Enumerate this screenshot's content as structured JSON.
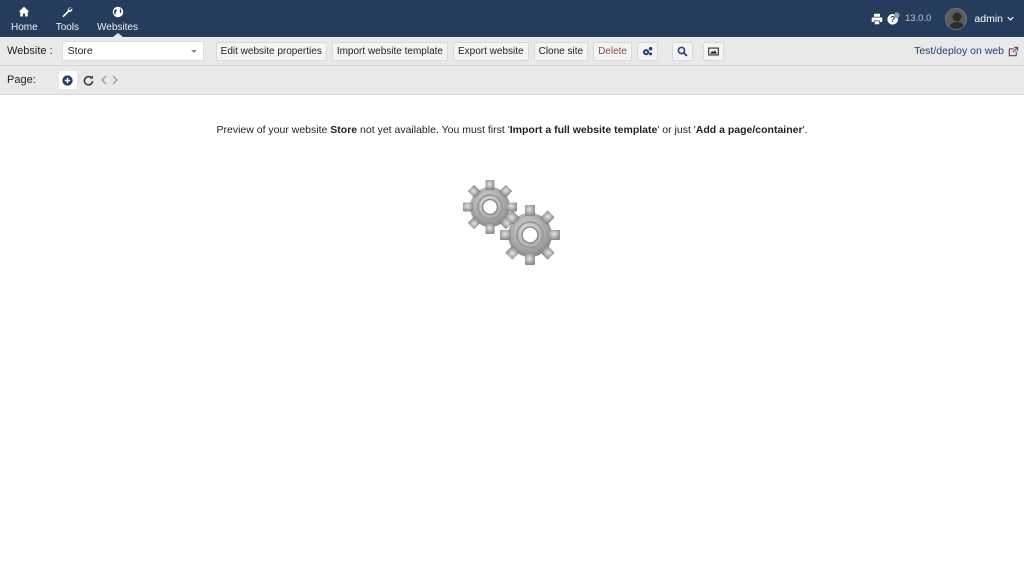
{
  "topbar": {
    "menu": [
      {
        "label": "Home",
        "icon": "home-icon"
      },
      {
        "label": "Tools",
        "icon": "wrench-icon"
      },
      {
        "label": "Websites",
        "icon": "globe-icon",
        "active": true
      }
    ],
    "version": "13.0.0",
    "user": "admin"
  },
  "toolbar": {
    "website_label": "Website :",
    "website_value": "Store",
    "buttons": {
      "edit": "Edit website properties",
      "import": "Import website template",
      "export": "Export website",
      "clone": "Clone site",
      "delete": "Delete"
    },
    "deploy_link": "Test/deploy on web"
  },
  "pagebar": {
    "label": "Page:"
  },
  "message": {
    "part1": "Preview of your website ",
    "site": "Store",
    "part2": " not yet available. You must first '",
    "link1": "Import a full website template",
    "part3": "' or just '",
    "link2": "Add a page/container",
    "part4": "'."
  },
  "colors": {
    "topbar": "#263c5c",
    "accent": "#263c70",
    "delete": "#8c4a4a"
  }
}
